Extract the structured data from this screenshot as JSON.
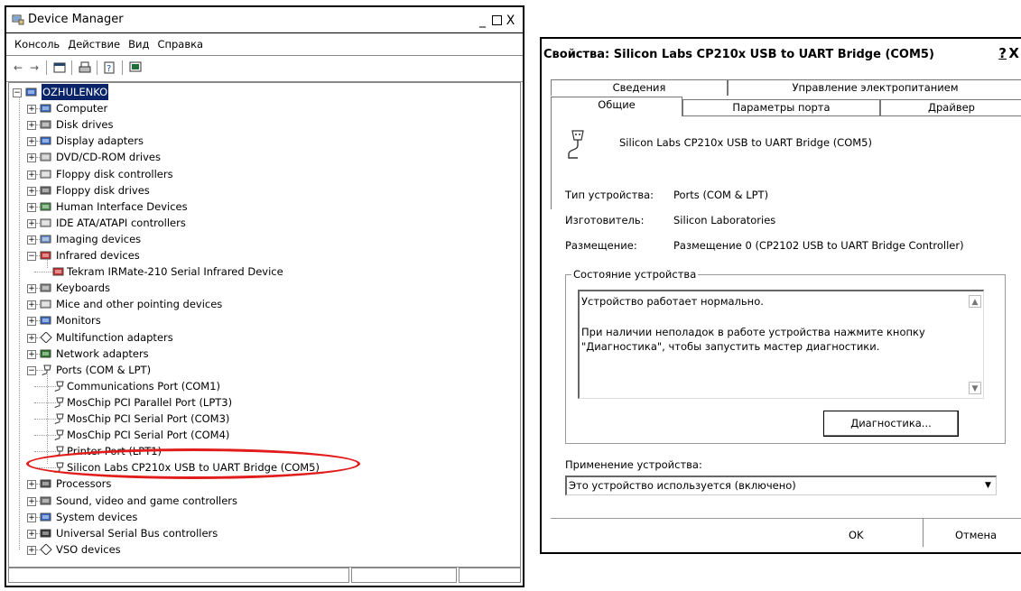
{
  "device_manager": {
    "title": "Device Manager",
    "caption_buttons": [
      "_",
      "□",
      "X"
    ],
    "menu": [
      "Консоль",
      "Действие",
      "Вид",
      "Справка"
    ],
    "toolbar_icons": [
      "back-arrow-icon",
      "forward-arrow-icon",
      "properties-icon",
      "print-icon",
      "help-icon",
      "scan-hardware-icon"
    ],
    "tree": {
      "root": "OZHULENKO",
      "items": [
        {
          "label": "Computer",
          "expanded": false,
          "icon": "computer-icon"
        },
        {
          "label": "Disk drives",
          "expanded": false,
          "icon": "disk-drive-icon"
        },
        {
          "label": "Display adapters",
          "expanded": false,
          "icon": "display-icon"
        },
        {
          "label": "DVD/CD-ROM drives",
          "expanded": false,
          "icon": "cdrom-icon"
        },
        {
          "label": "Floppy disk controllers",
          "expanded": false,
          "icon": "controller-icon"
        },
        {
          "label": "Floppy disk drives",
          "expanded": false,
          "icon": "floppy-icon"
        },
        {
          "label": "Human Interface Devices",
          "expanded": false,
          "icon": "hid-icon"
        },
        {
          "label": "IDE ATA/ATAPI controllers",
          "expanded": false,
          "icon": "controller-icon"
        },
        {
          "label": "Imaging devices",
          "expanded": false,
          "icon": "camera-icon"
        },
        {
          "label": "Infrared devices",
          "expanded": true,
          "icon": "infrared-icon",
          "children": [
            {
              "label": "Tekram IRMate-210 Serial Infrared Device",
              "icon": "infrared-device-icon"
            }
          ]
        },
        {
          "label": "Keyboards",
          "expanded": false,
          "icon": "keyboard-icon"
        },
        {
          "label": "Mice and other pointing devices",
          "expanded": false,
          "icon": "mouse-icon"
        },
        {
          "label": "Monitors",
          "expanded": false,
          "icon": "monitor-icon"
        },
        {
          "label": "Multifunction adapters",
          "expanded": false,
          "icon": "multifunction-icon"
        },
        {
          "label": "Network adapters",
          "expanded": false,
          "icon": "network-icon"
        },
        {
          "label": "Ports (COM & LPT)",
          "expanded": true,
          "icon": "port-icon",
          "children": [
            {
              "label": "Communications Port (COM1)",
              "icon": "port-icon"
            },
            {
              "label": "MosChip PCI Parallel Port (LPT3)",
              "icon": "port-icon"
            },
            {
              "label": "MosChip PCI Serial Port (COM3)",
              "icon": "port-icon"
            },
            {
              "label": "MosChip PCI Serial Port (COM4)",
              "icon": "port-icon"
            },
            {
              "label": "Printer Port (LPT1)",
              "icon": "port-icon"
            },
            {
              "label": "Silicon Labs CP210x USB to UART Bridge (COM5)",
              "icon": "port-icon"
            }
          ]
        },
        {
          "label": "Processors",
          "expanded": false,
          "icon": "cpu-icon"
        },
        {
          "label": "Sound, video and game controllers",
          "expanded": false,
          "icon": "sound-icon"
        },
        {
          "label": "System devices",
          "expanded": false,
          "icon": "system-icon"
        },
        {
          "label": "Universal Serial Bus controllers",
          "expanded": false,
          "icon": "usb-icon"
        },
        {
          "label": "VSO devices",
          "expanded": false,
          "icon": "vso-icon"
        }
      ]
    }
  },
  "properties_dialog": {
    "title": "Свойства: Silicon Labs CP210x USB to UART Bridge (COM5)",
    "help_button": "?",
    "close_button": "X",
    "tabs_back": [
      "Сведения",
      "Управление электропитанием"
    ],
    "tabs_front": [
      "Общие",
      "Параметры порта",
      "Драйвер"
    ],
    "active_tab": "Общие",
    "device_name": "Silicon Labs CP210x USB to UART Bridge (COM5)",
    "device_type_label": "Тип устройства:",
    "device_type_value": "Ports (COM & LPT)",
    "manufacturer_label": "Изготовитель:",
    "manufacturer_value": "Silicon Laboratories",
    "location_label": "Размещение:",
    "location_value": "Размещение 0 (CP2102 USB to UART Bridge Controller)",
    "status_group_label": "Состояние устройства",
    "status_line1": "Устройство работает нормально.",
    "status_line2": "При наличии неполадок в работе устройства нажмите кнопку",
    "status_line3": "\"Диагностика\", чтобы запустить мастер диагностики.",
    "diagnostics_button": "Диагностика...",
    "usage_label": "Применение устройства:",
    "usage_value": "Это устройство используется (включено)",
    "ok_button": "OK",
    "cancel_button": "Отмена"
  },
  "colors": {
    "highlight_ellipse": "#e21b1b",
    "selection": "#0a246a"
  }
}
